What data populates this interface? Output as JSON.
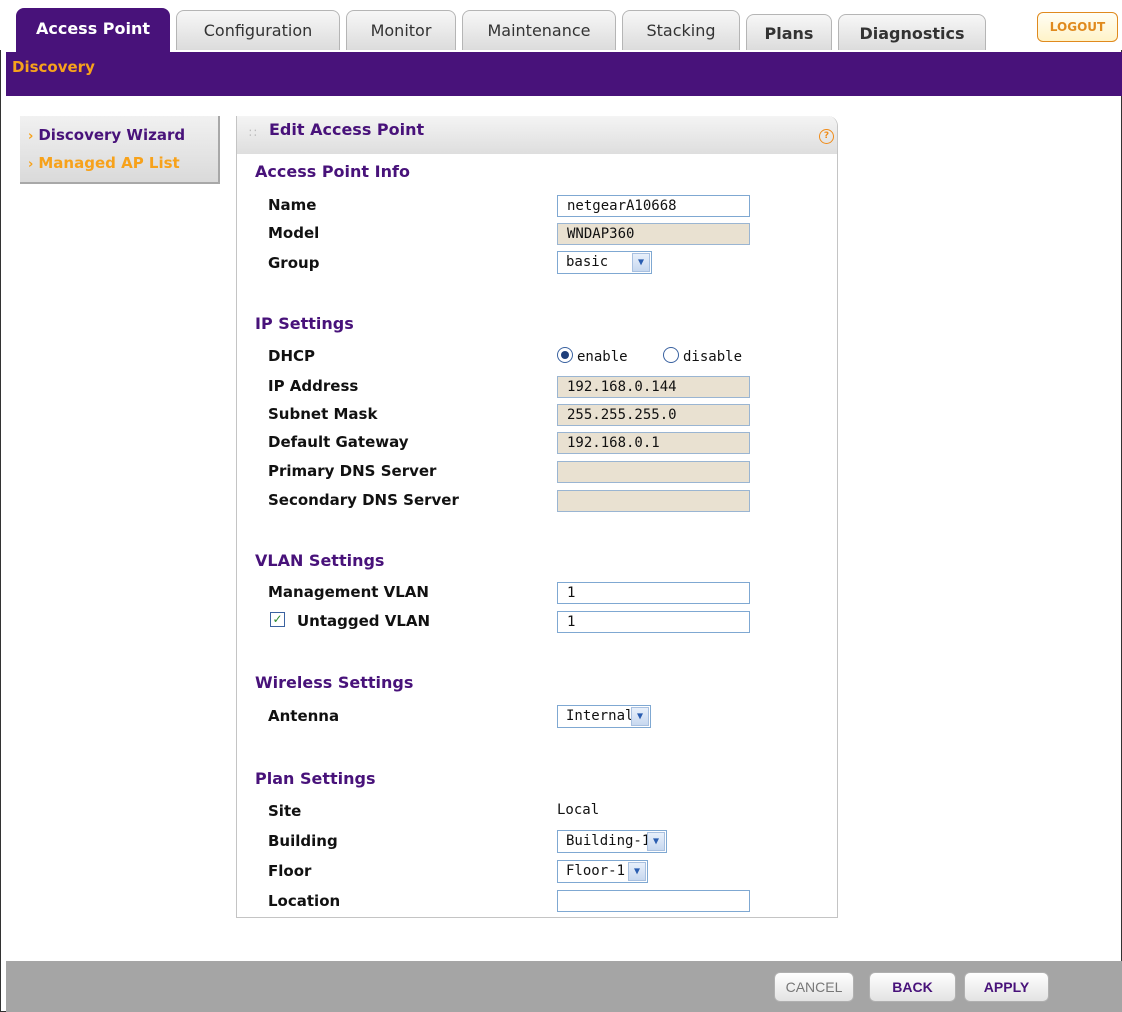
{
  "tabs": [
    {
      "label": "Access Point",
      "active": true
    },
    {
      "label": "Configuration",
      "active": false
    },
    {
      "label": "Monitor",
      "active": false
    },
    {
      "label": "Maintenance",
      "active": false
    },
    {
      "label": "Stacking",
      "active": false
    },
    {
      "label": "Plans",
      "active": false
    },
    {
      "label": "Diagnostics",
      "active": false
    }
  ],
  "logout_label": "LOGOUT",
  "subnav": {
    "active": "Discovery"
  },
  "sidebar": {
    "items": [
      {
        "label": "Discovery Wizard"
      },
      {
        "label": "Managed AP List"
      }
    ]
  },
  "panel": {
    "title": "Edit Access Point",
    "help_glyph": "?"
  },
  "access_point_info": {
    "heading": "Access Point Info",
    "name_label": "Name",
    "name_value": "netgearA10668",
    "model_label": "Model",
    "model_value": "WNDAP360",
    "group_label": "Group",
    "group_value": "basic"
  },
  "ip_settings": {
    "heading": "IP Settings",
    "dhcp_label": "DHCP",
    "dhcp_options": [
      "enable",
      "disable"
    ],
    "dhcp_selected": "enable",
    "ip_label": "IP Address",
    "ip_value": "192.168.0.144",
    "subnet_label": "Subnet Mask",
    "subnet_value": "255.255.255.0",
    "gateway_label": "Default Gateway",
    "gateway_value": "192.168.0.1",
    "primary_dns_label": "Primary DNS Server",
    "primary_dns_value": "",
    "secondary_dns_label": "Secondary DNS Server",
    "secondary_dns_value": ""
  },
  "vlan_settings": {
    "heading": "VLAN Settings",
    "mgmt_label": "Management VLAN",
    "mgmt_value": "1",
    "untagged_label": "Untagged VLAN",
    "untagged_checked": true,
    "untagged_value": "1"
  },
  "wireless_settings": {
    "heading": "Wireless Settings",
    "antenna_label": "Antenna",
    "antenna_value": "Internal"
  },
  "plan_settings": {
    "heading": "Plan Settings",
    "site_label": "Site",
    "site_value": "Local",
    "building_label": "Building",
    "building_value": "Building-1",
    "floor_label": "Floor",
    "floor_value": "Floor-1",
    "location_label": "Location",
    "location_value": ""
  },
  "footer": {
    "cancel_label": "CANCEL",
    "back_label": "BACK",
    "apply_label": "APPLY"
  },
  "colors": {
    "brand_purple": "#48127a",
    "accent_orange": "#f7a21b",
    "readonly_fill": "#e9e1d1",
    "footer_gray": "#a5a5a5"
  },
  "icons": {
    "dropdown": "chevron-down-icon",
    "help": "help-icon",
    "sidebar_bullet": "chevron-right-icon",
    "checkbox": "checkmark-icon"
  }
}
